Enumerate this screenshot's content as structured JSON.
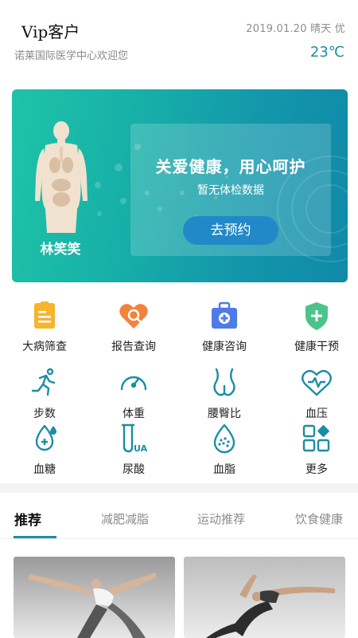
{
  "header": {
    "title": "Vip客户",
    "welcome": "诺莱国际医学中心欢迎您",
    "date_weather": "2019.01.20 晴天 优",
    "temperature": "23℃"
  },
  "banner": {
    "user_name": "林笑笑",
    "slogan": "关爱健康，用心呵护",
    "status": "暂无体检数据",
    "button_label": "去预约"
  },
  "services": [
    {
      "label": "大病筛查",
      "icon": "clipboard-icon",
      "color": "#f7b52c"
    },
    {
      "label": "报告查询",
      "icon": "heart-search-icon",
      "color": "#f2823c"
    },
    {
      "label": "健康咨询",
      "icon": "medical-kit-icon",
      "color": "#4f7be8"
    },
    {
      "label": "健康干预",
      "icon": "shield-plus-icon",
      "color": "#4cc38a"
    }
  ],
  "metrics": [
    {
      "label": "步数",
      "icon": "running-icon"
    },
    {
      "label": "体重",
      "icon": "gauge-icon"
    },
    {
      "label": "腰臀比",
      "icon": "waist-icon"
    },
    {
      "label": "血压",
      "icon": "heart-pulse-icon"
    },
    {
      "label": "血糖",
      "icon": "blood-sugar-icon"
    },
    {
      "label": "尿酸",
      "icon": "uric-acid-icon"
    },
    {
      "label": "血脂",
      "icon": "blood-lipid-icon"
    },
    {
      "label": "更多",
      "icon": "more-grid-icon"
    }
  ],
  "metric_icon_color": "#1a8ea3",
  "tabs": [
    {
      "label": "推荐",
      "active": true
    },
    {
      "label": "减肥减脂",
      "active": false
    },
    {
      "label": "运动推荐",
      "active": false
    },
    {
      "label": "饮食健康",
      "active": false
    }
  ],
  "accent_color": "#1a8ea3"
}
